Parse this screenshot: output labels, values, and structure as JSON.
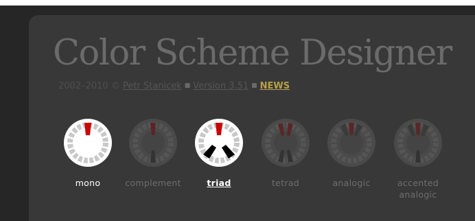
{
  "header": {
    "title": "Color Scheme Designer",
    "years": "2002–2010 ©",
    "author_link": "Petr Stanicek",
    "version_link": "Version 3.51",
    "news_link": "NEWS"
  },
  "modes": [
    {
      "label": "mono",
      "icon": "mono-wheel-icon",
      "state": "active"
    },
    {
      "label": "complement",
      "icon": "complement-wheel-icon",
      "state": "inactive"
    },
    {
      "label": "triad",
      "icon": "triad-wheel-icon",
      "state": "selected"
    },
    {
      "label": "tetrad",
      "icon": "tetrad-wheel-icon",
      "state": "inactive"
    },
    {
      "label": "analogic",
      "icon": "analogic-wheel-icon",
      "state": "inactive"
    },
    {
      "label": "accented analogic",
      "icon": "accented-analogic-wheel-icon",
      "state": "inactive"
    }
  ],
  "colors": {
    "background": "#262626",
    "panel": "#383838",
    "title": "#6b6b6b",
    "news": "#b8a04a",
    "accent_red": "#cc0000"
  }
}
